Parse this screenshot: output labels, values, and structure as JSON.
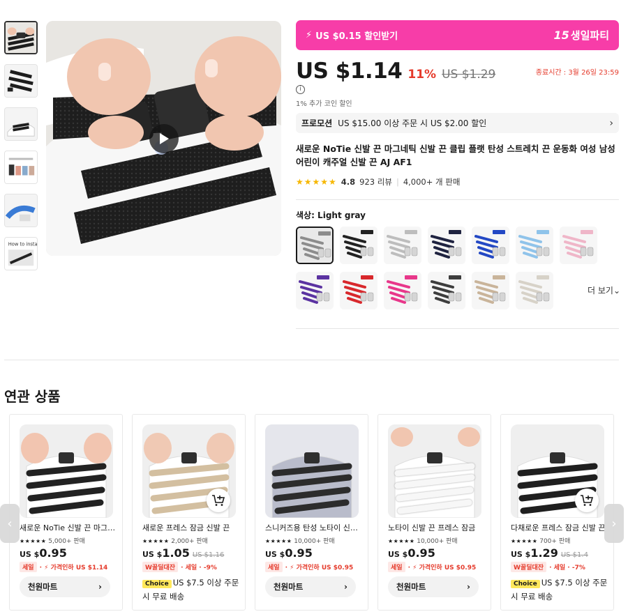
{
  "gallery": {
    "thumbnails": [
      "shoelace-black-clip",
      "shoelace-black-lace",
      "shoelace-black-shoe",
      "color-options",
      "blue-shoe-instructions",
      "how-to-install"
    ],
    "active_index": 0,
    "thumb_6_caption": "How to install"
  },
  "banner": {
    "coupon_text": "US $0.15 할인받기",
    "event_badge": "15",
    "event_text": "생일파티",
    "color": "#f73da8"
  },
  "price": {
    "current": "US $1.14",
    "discount": "11%",
    "original": "US $1.29",
    "end_time": "종료시간 : 3월 26일 23:59"
  },
  "coin": {
    "info_icon": "i",
    "text": "1% 추가 코인 할인"
  },
  "promotion": {
    "tag": "프로모션",
    "text": "US $15.00 이상 주문 시 US $2.00 할인",
    "chevron": "›"
  },
  "product": {
    "title": "새로운 NoTie 신발 끈 마그네틱 신발 끈 클립 플랫 탄성 스트레치 끈 운동화 여성 남성 어린이 캐주얼 신발 끈 AJ AF1",
    "stars": "★★★★★",
    "rating": "4.8",
    "reviews": "923 리뷰",
    "sold": "4,000+ 개 판매"
  },
  "colors": {
    "label": "색상: Light gray",
    "more": "더 보기",
    "options": [
      {
        "name": "Light gray",
        "lace": "#8c8c8c",
        "label": "Light gray",
        "active": true
      },
      {
        "name": "Black",
        "lace": "#222222",
        "label": "Black"
      },
      {
        "name": "White",
        "lace": "#bdbdbd",
        "label": "White"
      },
      {
        "name": "Navy blue",
        "lace": "#1f2340",
        "label": "Navy blue"
      },
      {
        "name": "Royal blue",
        "lace": "#2348c4",
        "label": "Royal blue"
      },
      {
        "name": "Sky blue",
        "lace": "#8fc3ea",
        "label": "Sky blue"
      },
      {
        "name": "pink",
        "lace": "#efb6c8",
        "label": "pink"
      },
      {
        "name": "purple",
        "lace": "#5b33a1",
        "label": "purple"
      },
      {
        "name": "Red",
        "lace": "#d8282c",
        "label": "Red"
      },
      {
        "name": "Rose red",
        "lace": "#e8378a",
        "label": "Rose red"
      },
      {
        "name": "Gray",
        "lace": "#3d3d3d",
        "label": "Gray"
      },
      {
        "name": "Beige",
        "lace": "#c9b49a",
        "label": "Beige"
      },
      {
        "name": "Cream",
        "lace": "#d7d2c8",
        "label": "Cream"
      }
    ]
  },
  "related": {
    "title": "연관 상품",
    "cards": [
      {
        "name": "새로운 NoTie 신발 끈 마그네틱",
        "stars": "★★★★★",
        "sold": "5,000+ 판매",
        "price_prefix": "US $",
        "price": "0.95",
        "old_price": "",
        "tag": "세일",
        "tag_extra": "· ⚡ 가격인하 US $1.14",
        "bottom_type": "store",
        "bottom_text": "천원마트",
        "cart": false,
        "lace": "#222222",
        "skin": "#f2c5b0"
      },
      {
        "name": "새로운 프레스 잠금 신발 끈",
        "stars": "★★★★★",
        "sold": "2,000+ 판매",
        "price_prefix": "US $",
        "price": "1.05",
        "old_price": "US $1.16",
        "tag": "W꿀딜대잔",
        "tag_extra": "· 세일 · -9%",
        "bottom_type": "ship",
        "choice": "Choice",
        "bottom_text": "US $7.5 이상 주문 시 무료 배송",
        "cart": true,
        "lace": "#d3bfa0",
        "skin": "#f0c9b4"
      },
      {
        "name": "스니커즈용 탄성 노타이 신발 끈",
        "stars": "★★★★★",
        "sold": "10,000+ 판매",
        "price_prefix": "US $",
        "price": "0.95",
        "old_price": "",
        "tag": "세일",
        "tag_extra": "· ⚡ 가격인하 US $0.95",
        "bottom_type": "store",
        "bottom_text": "천원마트",
        "cart": false,
        "lace": "#2c2c2c",
        "skin": "#9b9fb0"
      },
      {
        "name": "노타이 신발 끈 프레스 잠금",
        "stars": "★★★★★",
        "sold": "10,000+ 판매",
        "price_prefix": "US $",
        "price": "0.95",
        "old_price": "",
        "tag": "세일",
        "tag_extra": "· ⚡ 가격인하 US $0.95",
        "bottom_type": "store",
        "bottom_text": "천원마트",
        "cart": false,
        "lace": "#f7f7f7",
        "skin": "#e8e8e8"
      },
      {
        "name": "다채로운 프레스 잠금 신발 끈",
        "stars": "★★★★★",
        "sold": "700+ 판매",
        "price_prefix": "US $",
        "price": "1.29",
        "old_price": "US $1.4",
        "tag": "W꿀딜대잔",
        "tag_extra": "· 세일 · -7%",
        "bottom_type": "ship",
        "choice": "Choice",
        "bottom_text": "US $7.5 이상 주문 시 무료 배송",
        "cart": true,
        "lace": "#1f1f1f",
        "skin": "#f1f1f1"
      }
    ],
    "prev_arrow": "‹",
    "next_arrow": "›"
  }
}
